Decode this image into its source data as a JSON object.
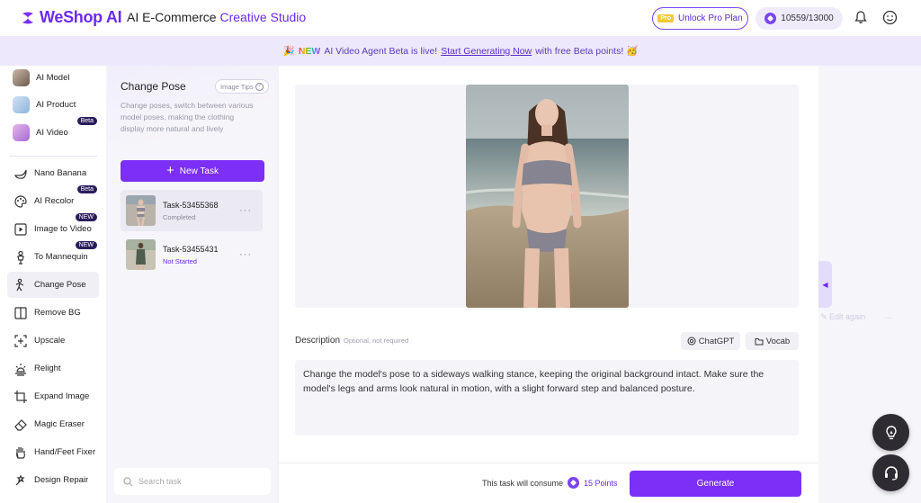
{
  "header": {
    "logo_text": "WeShop AI",
    "app_title_prefix": "AI E-Commerce ",
    "app_title_accent": "Creative Studio",
    "pro_badge": "Pro",
    "unlock_label": "Unlock Pro Plan",
    "points": "10559/13000",
    "accent_color": "#7b2ff7"
  },
  "banner": {
    "emoji_party": "🎉",
    "new_word": "NEW",
    "text_before": "AI Video Agent Beta is live!",
    "link_text": "Start Generating Now",
    "text_after": "with free Beta points! 🥳"
  },
  "sidebar": {
    "items": [
      {
        "label": "AI Model",
        "icon": "ai-model-thumb"
      },
      {
        "label": "AI Product",
        "icon": "ai-product-thumb"
      },
      {
        "label": "AI Video",
        "icon": "ai-video-thumb",
        "tag": "Beta"
      },
      {
        "label": "Nano Banana",
        "icon": "banana-icon"
      },
      {
        "label": "AI Recolor",
        "icon": "palette-icon",
        "tag": "Beta"
      },
      {
        "label": "Image to Video",
        "icon": "video-icon",
        "tag": "NEW"
      },
      {
        "label": "To Mannequin",
        "icon": "mannequin-icon",
        "tag": "NEW"
      },
      {
        "label": "Change Pose",
        "icon": "pose-icon"
      },
      {
        "label": "Remove BG",
        "icon": "remove-bg-icon"
      },
      {
        "label": "Upscale",
        "icon": "upscale-icon"
      },
      {
        "label": "Relight",
        "icon": "relight-icon"
      },
      {
        "label": "Expand Image",
        "icon": "expand-icon"
      },
      {
        "label": "Magic Eraser",
        "icon": "eraser-icon"
      },
      {
        "label": "Hand/Feet Fixer",
        "icon": "hand-icon"
      },
      {
        "label": "Design Repair",
        "icon": "repair-icon"
      }
    ]
  },
  "task_panel": {
    "title": "Change Pose",
    "image_tips": "Image Tips",
    "description": "Change poses, switch between various model poses, making the clothing display more natural and lively",
    "new_task": "New Task",
    "tasks": [
      {
        "name": "Task-53455368",
        "status": "Completed",
        "status_color": "#8b879a"
      },
      {
        "name": "Task-53455431",
        "status": "Not Started",
        "status_color": "#6b2bf0"
      }
    ],
    "search_placeholder": "Search task"
  },
  "main": {
    "description_label": "Description",
    "description_note": "Optional, not required",
    "chatgpt_label": "ChatGPT",
    "vocab_label": "Vocab",
    "description_text": "Change the model's pose to a sideways walking stance, keeping the original background intact. Make sure the model's legs and arms look natural in motion, with a slight forward step and balanced posture.",
    "consume_text": "This task will consume",
    "points_text": "15 Points",
    "generate_label": "Generate"
  },
  "right_panel": {
    "edit_again": "Edit again",
    "more": "..."
  }
}
